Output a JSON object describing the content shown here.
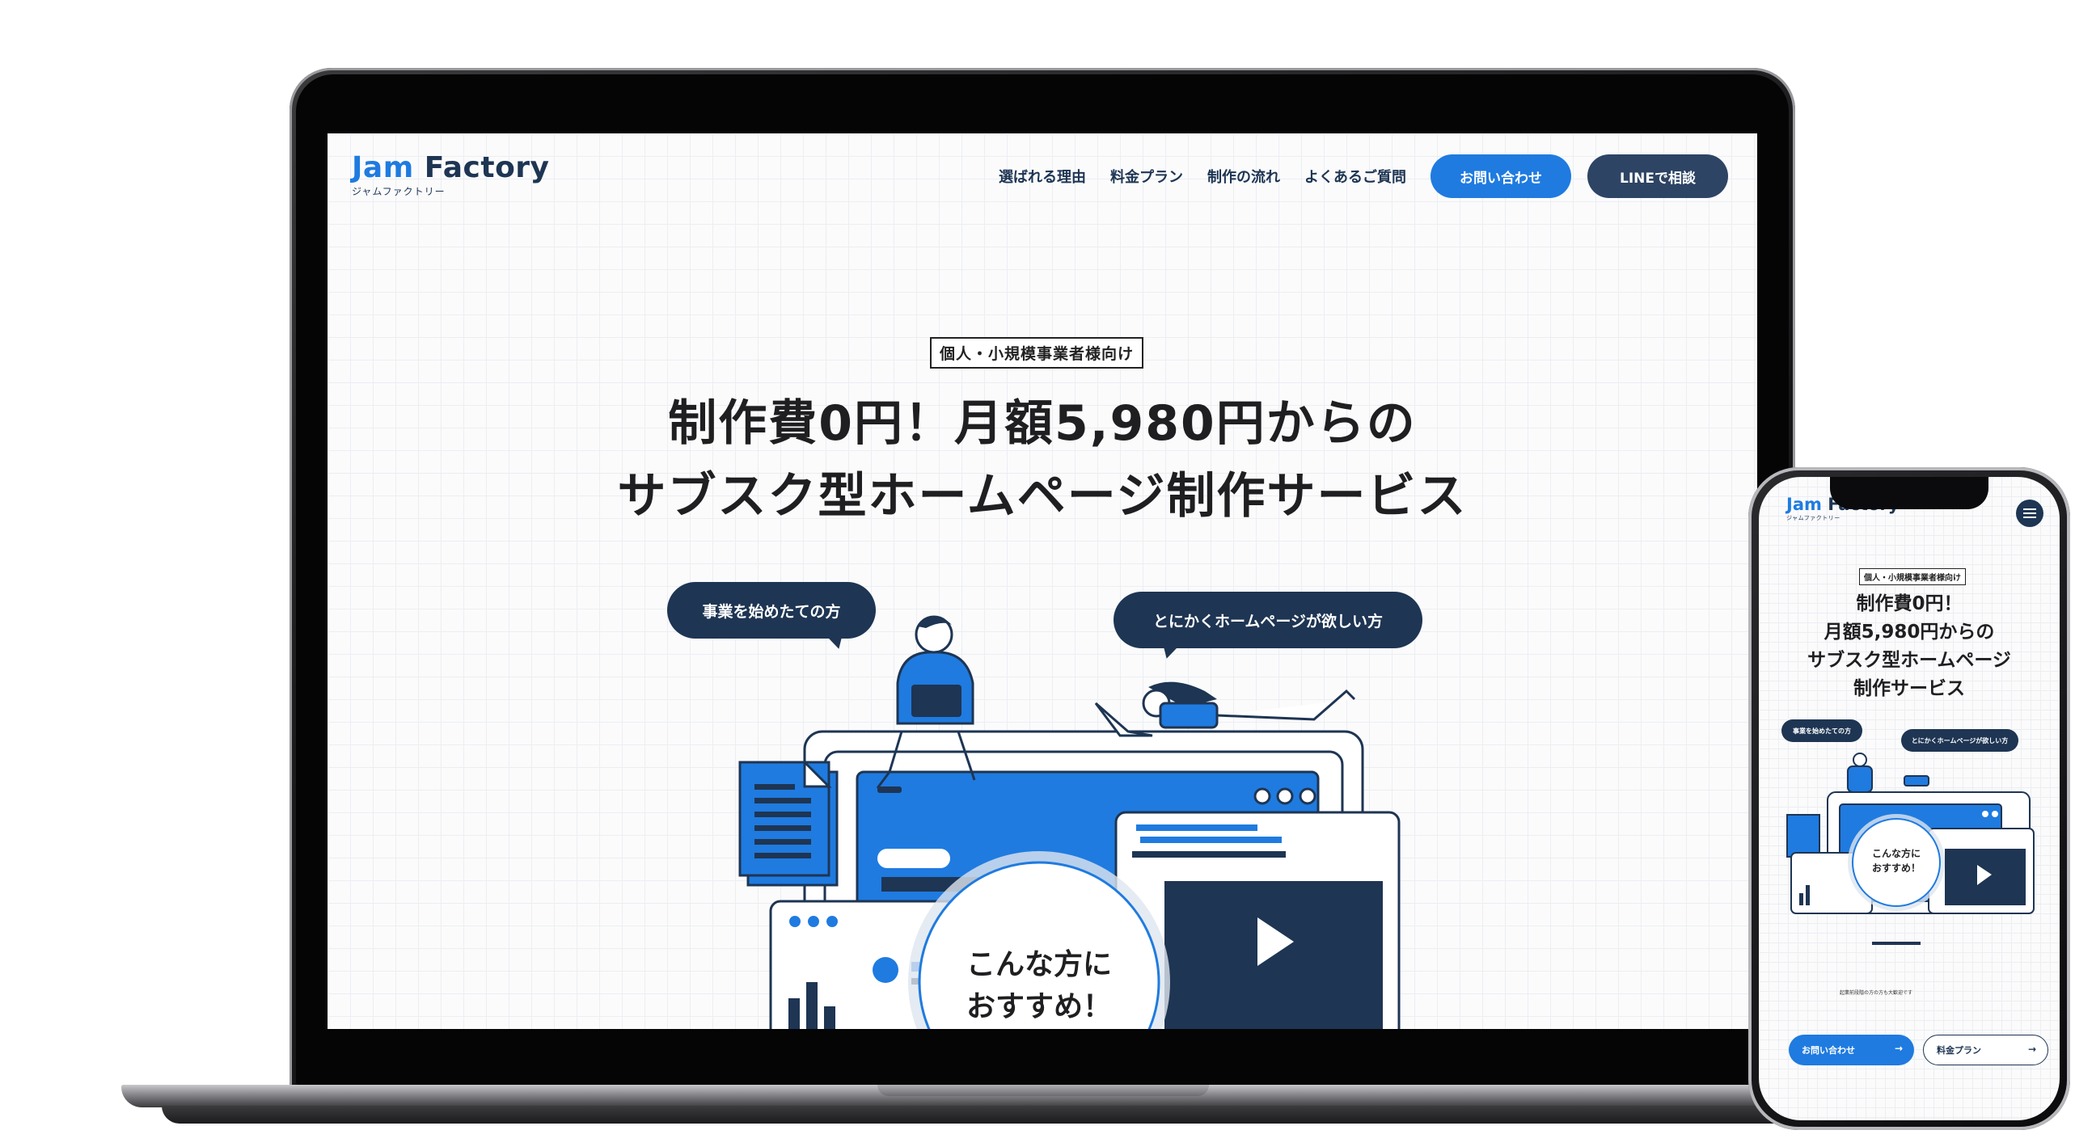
{
  "desktop": {
    "logo": {
      "jam": "Jam",
      "factory": "Factory",
      "sub": "ジャムファクトリー"
    },
    "nav": {
      "items": [
        "選ばれる理由",
        "料金プラン",
        "制作の流れ",
        "よくあるご質問"
      ],
      "contact_button": "お問い合わせ",
      "line_button": "LINEで相談"
    },
    "hero": {
      "tag": "個人・小規模事業者様向け",
      "headline_line1": "制作費0円！月額5,980円からの",
      "headline_line2": "サブスク型ホームページ制作サービス",
      "bubble_left": "事業を始めたての方",
      "bubble_right": "とにかくホームページが欲しい方",
      "circle_line1": "こんな方に",
      "circle_line2": "おすすめ！"
    }
  },
  "mobile": {
    "logo": {
      "jam": "Jam",
      "factory": "Factory",
      "sub": "ジャムファクトリー"
    },
    "tag": "個人・小規模事業者様向け",
    "headline": [
      "制作費0円！",
      "月額5,980円からの",
      "サブスク型ホームページ",
      "制作サービス"
    ],
    "bubble_left": "事業を始めたての方",
    "bubble_right": "とにかくホームページが欲しい方",
    "circle_line1": "こんな方に",
    "circle_line2": "おすすめ！",
    "note": "起業前段階の方の方も大歓迎です",
    "contact_button": "お問い合わせ",
    "plan_button": "料金プラン",
    "arrow": "→"
  },
  "colors": {
    "brand_blue": "#1f7be0",
    "navy": "#1e3553",
    "dark_navy": "#2d4464"
  }
}
